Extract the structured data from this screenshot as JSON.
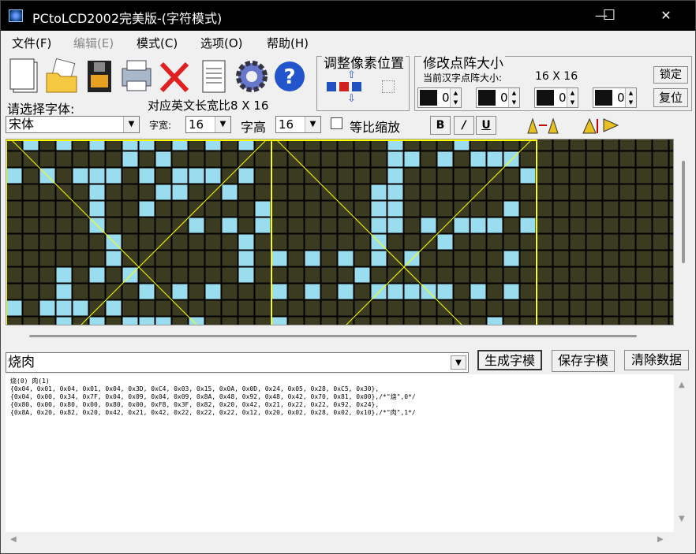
{
  "window": {
    "title": "PCtoLCD2002完美版-(字符模式)",
    "minimize": "—",
    "maximize": "☐",
    "close": "✕"
  },
  "menu": [
    {
      "label": "文件(F)",
      "disabled": false
    },
    {
      "label": "编辑(E)",
      "disabled": true
    },
    {
      "label": "模式(C)",
      "disabled": false
    },
    {
      "label": "选项(O)",
      "disabled": false
    },
    {
      "label": "帮助(H)",
      "disabled": false
    }
  ],
  "toolbar": {
    "icons": [
      "new-document-icon",
      "open-folder-icon",
      "save-disk-icon",
      "print-icon",
      "delete-icon",
      "notepad-icon",
      "settings-gear-icon",
      "help-icon"
    ]
  },
  "pixel_adjust": {
    "label": "调整像素位置"
  },
  "dot_matrix": {
    "label": "修改点阵大小",
    "current_label": "当前汉字点阵大小:",
    "current_size": "16 X 16",
    "lock": "锁定",
    "reset": "复位",
    "spinners": [
      "0",
      "0",
      "0",
      "0"
    ]
  },
  "font": {
    "select_label": "请选择字体:",
    "ratio_label": "对应英文长宽比8 X 16",
    "name": "宋体",
    "width_label": "字宽:",
    "width": "16",
    "height_label": "字高",
    "height": "16",
    "proportional_label": "等比缩放",
    "bold": "B",
    "italic": "/",
    "underline": "U"
  },
  "input": {
    "text": "烧肉"
  },
  "buttons": {
    "generate": "生成字模",
    "save": "保存字模",
    "clear": "清除数据"
  },
  "output": {
    "lines": [
      "烧(0) 肉(1)",
      "",
      "{0x04, 0x01, 0x04, 0x01, 0x04, 0x3D, 0xC4, 0x03, 0x15, 0x0A, 0x0D, 0x24, 0x05, 0x28, 0xC5, 0x30},",
      "{0x04, 0x00, 0x34, 0x7F, 0x04, 0x09, 0x04, 0x09, 0x8A, 0x48, 0x92, 0x48, 0x42, 0x70, 0x81, 0x00},/*\"烧\",0*/",
      "{0x80, 0x00, 0x80, 0x00, 0x80, 0x00, 0xF8, 0x3F, 0x82, 0x20, 0x42, 0x21, 0x22, 0x22, 0x92, 0x24},",
      "{0x8A, 0x20, 0x82, 0x20, 0x42, 0x21, 0x42, 0x22, 0x22, 0x22, 0x12, 0x20, 0x02, 0x28, 0x02, 0x10},/*\"肉\",1*/"
    ]
  },
  "colors": {
    "grid_bg": "#3b3b21",
    "pixel_on": "#99ddee",
    "cell_line": "#000000",
    "divider": "#ffff00"
  }
}
